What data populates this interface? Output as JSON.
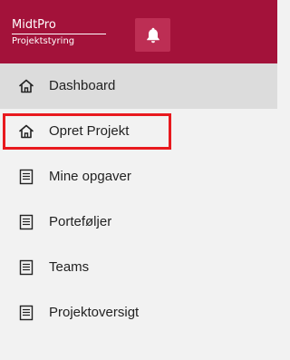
{
  "header": {
    "brand_name": "MidtPro",
    "brand_sub": "Projektstyring",
    "bell_icon": "bell-icon",
    "colors": {
      "bar": "#a3123a",
      "button": "#bd2e54"
    }
  },
  "menu": {
    "items": [
      {
        "label": "Dashboard",
        "icon": "home-icon"
      },
      {
        "label": "Opret Projekt",
        "icon": "home-icon"
      },
      {
        "label": "Mine opgaver",
        "icon": "document-icon"
      },
      {
        "label": "Porteføljer",
        "icon": "document-icon"
      },
      {
        "label": "Teams",
        "icon": "document-icon"
      },
      {
        "label": "Projektoversigt",
        "icon": "document-icon"
      }
    ],
    "highlight_color": "#e8191e"
  }
}
